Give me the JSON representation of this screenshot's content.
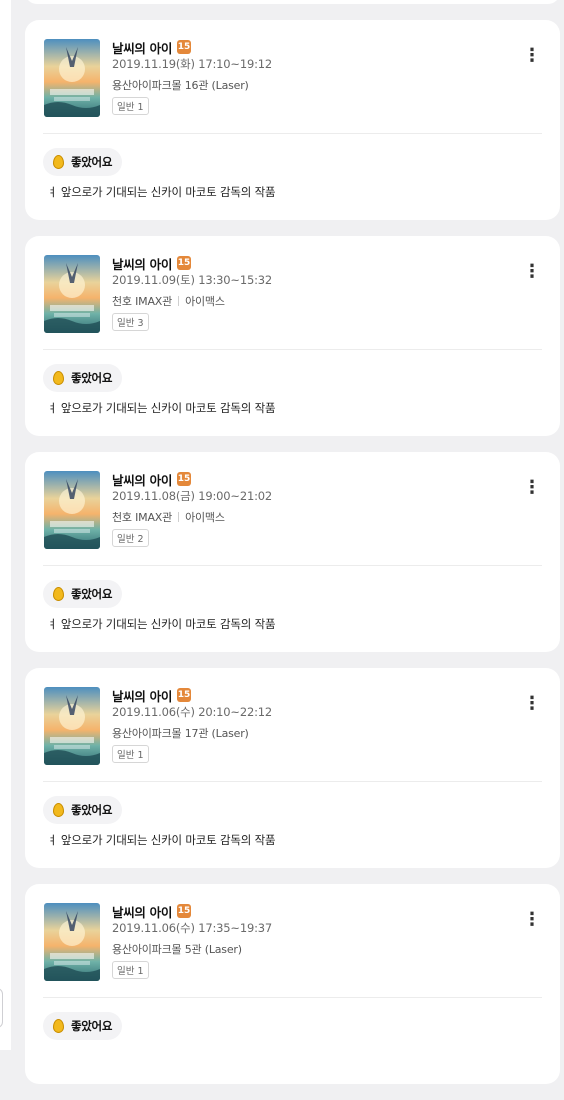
{
  "cards": [
    {
      "title": "날씨의 아이",
      "age_rating": "15",
      "datetime": "2019.11.19(화) 17:10~19:12",
      "theater": "용산아이파크몰 16관 (Laser)",
      "format": "",
      "seat": "일반 1",
      "reaction": "좋았어요",
      "review": "ㅕ 앞으로가 기대되는 신카이 마코토 감독의 작품"
    },
    {
      "title": "날씨의 아이",
      "age_rating": "15",
      "datetime": "2019.11.09(토) 13:30~15:32",
      "theater": "천호 IMAX관",
      "format": "아이맥스",
      "seat": "일반 3",
      "reaction": "좋았어요",
      "review": "ㅕ 앞으로가 기대되는 신카이 마코토 감독의 작품"
    },
    {
      "title": "날씨의 아이",
      "age_rating": "15",
      "datetime": "2019.11.08(금) 19:00~21:02",
      "theater": "천호 IMAX관",
      "format": "아이맥스",
      "seat": "일반 2",
      "reaction": "좋았어요",
      "review": "ㅕ 앞으로가 기대되는 신카이 마코토 감독의 작품"
    },
    {
      "title": "날씨의 아이",
      "age_rating": "15",
      "datetime": "2019.11.06(수) 20:10~22:12",
      "theater": "용산아이파크몰 17관 (Laser)",
      "format": "",
      "seat": "일반 1",
      "reaction": "좋았어요",
      "review": "ㅕ 앞으로가 기대되는 신카이 마코토 감독의 작품"
    },
    {
      "title": "날씨의 아이",
      "age_rating": "15",
      "datetime": "2019.11.06(수) 17:35~19:37",
      "theater": "용산아이파크몰 5관 (Laser)",
      "format": "",
      "seat": "일반 1",
      "reaction": "좋았어요",
      "review": ""
    }
  ],
  "colors": {
    "age_badge": "#e4883a",
    "egg": "#f2b91d",
    "page_bg": "#f0f0f2"
  },
  "icons": {
    "more": "vertical-ellipsis-icon",
    "reaction": "golden-egg-icon"
  }
}
